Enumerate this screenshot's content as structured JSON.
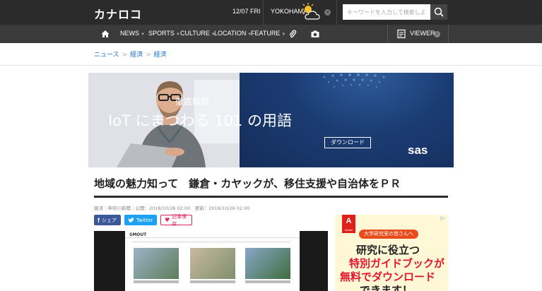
{
  "header": {
    "logo": "カナロコ",
    "date": "12/07 FRI",
    "city": "YOKOHAMA",
    "weather_icon": "partly-cloudy-icon",
    "search_placeholder": "キーワードを入力して検索しよう"
  },
  "nav": {
    "items": [
      {
        "label": "NEWS"
      },
      {
        "label": "SPORTS"
      },
      {
        "label": "CULTURE"
      },
      {
        "label": "LOCATION"
      },
      {
        "label": "FEATURE"
      }
    ],
    "viewer_label": "VIEWER"
  },
  "breadcrumb": [
    "ニュース",
    "経済",
    "経済"
  ],
  "banner": {
    "subtitle": "徹底解説",
    "title": "IoT にまつわる 101 の用語",
    "button": "ダウンロード",
    "logo": "sas"
  },
  "article": {
    "headline": "地域の魅力知って　鎌倉・カヤックが、移住支援や自治体をＰＲ",
    "meta": "経済｜神奈川新聞｜公開：2018/10/26 02:00　更新：2018/10/26 02:00",
    "share_facebook": "シェア",
    "share_twitter": "Twitter",
    "share_save": "記事保存",
    "image_brand": "SMOUT"
  },
  "side_ad": {
    "brand": "A",
    "brand_sub": "Adobe",
    "pill": "大学研究室の皆さんへ",
    "line1": "研究に役立つ",
    "line2": "特別ガイドブックが",
    "line3": "無料でダウンロード",
    "line4": "できます！"
  },
  "colors": {
    "header_bg": "#2b2b2b",
    "nav_bg": "#3b3b3b",
    "link": "#1a73c8",
    "banner_blue": "#1b3c73",
    "facebook": "#3b5998",
    "twitter": "#1da1f2",
    "save": "#e0245e",
    "ad_red": "#e5152c"
  }
}
